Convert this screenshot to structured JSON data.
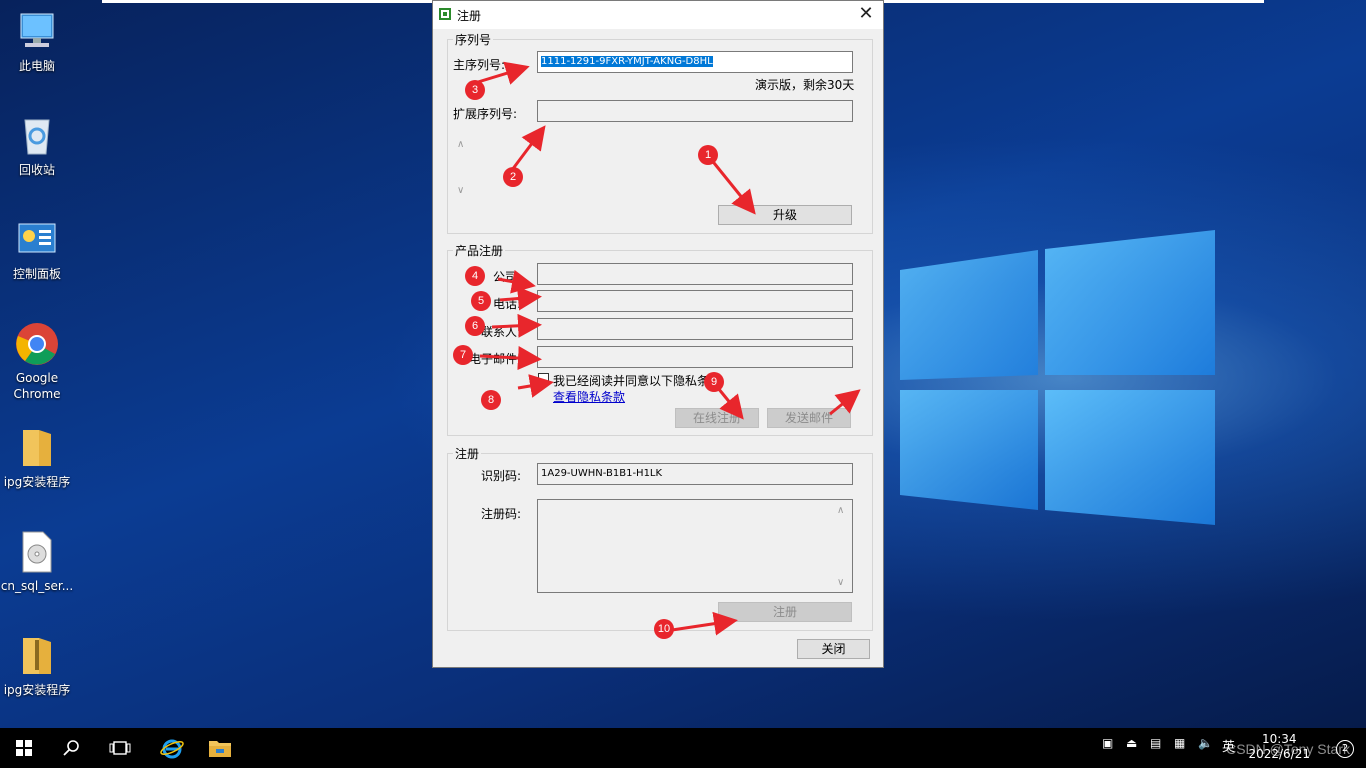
{
  "desktop": {
    "icons": [
      {
        "label": "此电脑",
        "icon": "computer-icon"
      },
      {
        "label": "回收站",
        "icon": "recycle-bin-icon"
      },
      {
        "label": "控制面板",
        "icon": "control-panel-icon"
      },
      {
        "label": "Google Chrome",
        "icon": "chrome-icon"
      },
      {
        "label": "ipg安装程序",
        "icon": "folder-icon"
      },
      {
        "label": "cn_sql_ser...",
        "icon": "disc-image-icon"
      },
      {
        "label": "ipg安装程序",
        "icon": "zip-folder-icon"
      }
    ]
  },
  "dialog": {
    "title": "注册",
    "serial_group": {
      "title": "序列号",
      "main_serial_label": "主序列号:",
      "main_serial_value": "1111-1291-9FXR-YMJT-AKNG-D8HL",
      "trial_text": "演示版，剩余30天",
      "ext_serial_label": "扩展序列号:",
      "ext_serial_value": "",
      "upgrade_button": "升级"
    },
    "product_group": {
      "title": "产品注册",
      "company_label": "公司:",
      "phone_label": "电话:",
      "contact_label": "联系人:",
      "email_label": "电子邮件:",
      "privacy_check_label": "我已经阅读并同意以下隐私条款",
      "privacy_link": "查看隐私条款",
      "online_register_button": "在线注册",
      "send_email_button": "发送邮件"
    },
    "register_group": {
      "title": "注册",
      "id_label": "识别码:",
      "id_value": "1A29-UWHN-B1B1-H1LK",
      "reg_code_label": "注册码:",
      "reg_code_value": "",
      "register_button": "注册"
    },
    "close_button": "关闭"
  },
  "annotations": [
    "1",
    "2",
    "3",
    "4",
    "5",
    "6",
    "7",
    "8",
    "9",
    "10"
  ],
  "taskbar": {
    "ime": "英",
    "time": "10:34",
    "date": "2022/6/21",
    "notification_count": "2"
  },
  "watermark": "CSDN @Tony Stark",
  "colors": {
    "accent": "#0078d7",
    "marker": "#e8262c"
  }
}
